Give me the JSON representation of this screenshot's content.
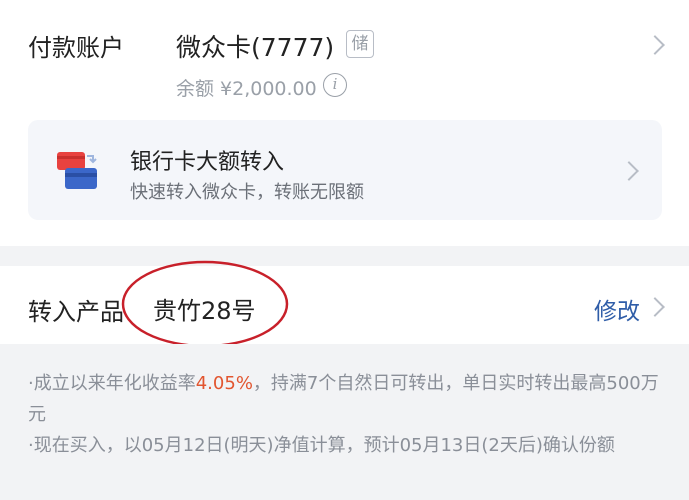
{
  "account": {
    "label": "付款账户",
    "card_name": "微众卡(7777)",
    "card_tag": "储",
    "balance": "余额 ¥2,000.00",
    "info_icon": "i"
  },
  "bank_transfer": {
    "title": "银行卡大额转入",
    "subtitle": "快速转入微众卡，转账无限额",
    "icon": "bank-cards-icon"
  },
  "product": {
    "label": "转入产品",
    "name": "贵竹28号",
    "modify_label": "修改"
  },
  "info": {
    "line1_pre": "·成立以来年化收益率",
    "line1_rate": "4.05%",
    "line1_post": "，持满7个自然日可转出，单日实时转出最高500万元",
    "line2": "·现在买入，以05月12日(明天)净值计算，预计05月13日(2天后)确认份额"
  },
  "colors": {
    "accent_blue": "#2f5da8",
    "rate_orange": "#e2552f",
    "annotation_red": "#c8202a"
  }
}
